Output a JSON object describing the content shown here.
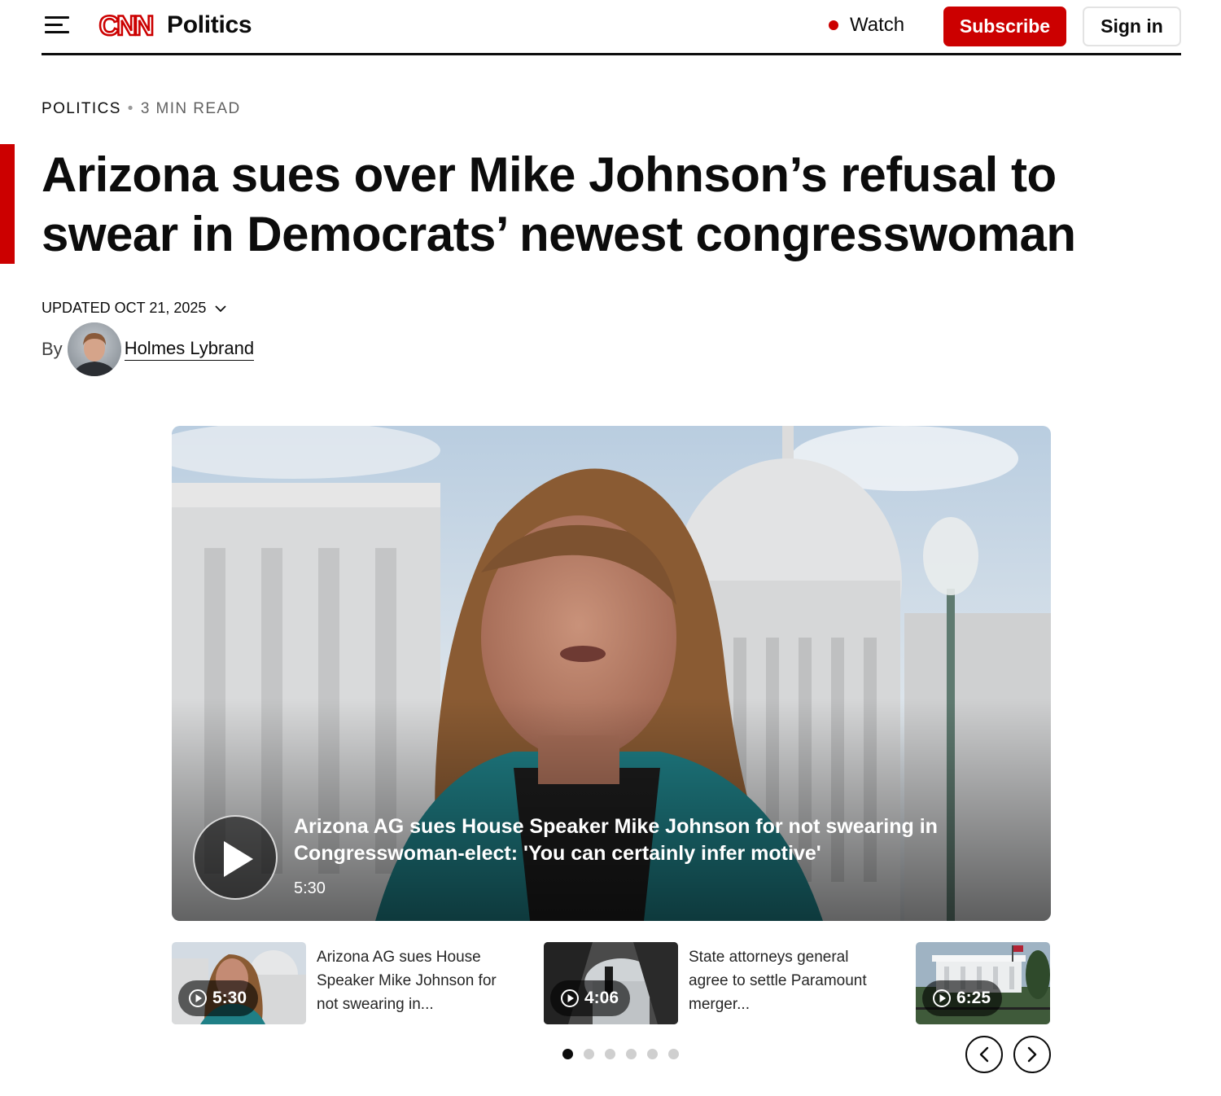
{
  "header": {
    "logo_text": "CNN",
    "section": "Politics",
    "watch_label": "Watch",
    "subscribe_label": "Subscribe",
    "signin_label": "Sign in"
  },
  "article": {
    "kicker_section": "POLITICS",
    "kicker_readtime": "3 MIN READ",
    "headline": "Arizona sues over Mike Johnson’s refusal to swear in Democrats’ newest congresswoman",
    "updated": "UPDATED OCT 21, 2025",
    "by_label": "By",
    "author": "Holmes Lybrand"
  },
  "video": {
    "title": "Arizona AG sues House Speaker Mike Johnson for not swearing in Congresswoman-elect: 'You can certainly infer motive'",
    "duration": "5:30"
  },
  "carousel": {
    "items": [
      {
        "duration": "5:30",
        "text": "Arizona AG sues House Speaker Mike Johnson for not swearing in..."
      },
      {
        "duration": "4:06",
        "text": "State attorneys general agree to settle Paramount merger..."
      },
      {
        "duration": "6:25",
        "text": ""
      }
    ],
    "active_page": 1,
    "page_count": 6
  },
  "colors": {
    "brand_red": "#cc0000",
    "text": "#0c0c0c"
  },
  "icons": [
    "hamburger-menu-icon",
    "live-dot-icon",
    "chevron-down-icon",
    "play-icon",
    "play-circle-icon",
    "chevron-left-icon",
    "chevron-right-icon"
  ]
}
